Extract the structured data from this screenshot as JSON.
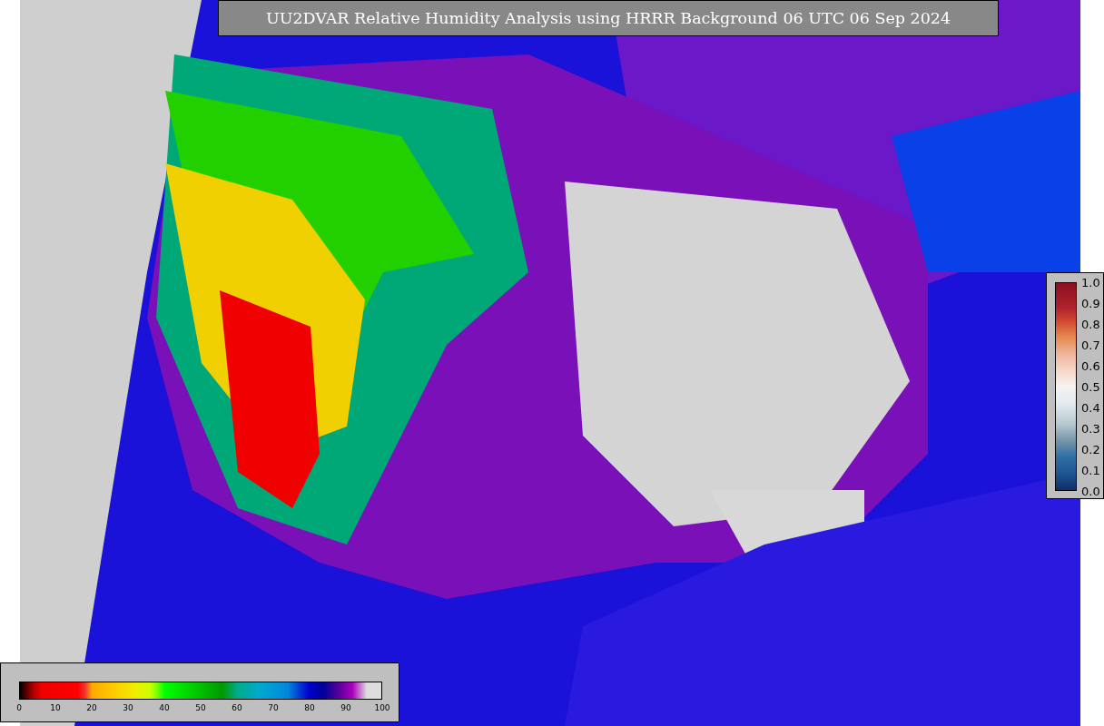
{
  "title": "UU2DVAR Relative Humidity Analysis using HRRR Background 06 UTC 06 Sep 2024",
  "humidity_colorbar": {
    "ticks": [
      "0",
      "10",
      "20",
      "30",
      "40",
      "50",
      "60",
      "70",
      "80",
      "90",
      "100"
    ]
  },
  "station_colorbar": {
    "ticks": [
      "1.0",
      "0.9",
      "0.8",
      "0.7",
      "0.6",
      "0.5",
      "0.4",
      "0.3",
      "0.2",
      "0.1",
      "0.0"
    ]
  }
}
